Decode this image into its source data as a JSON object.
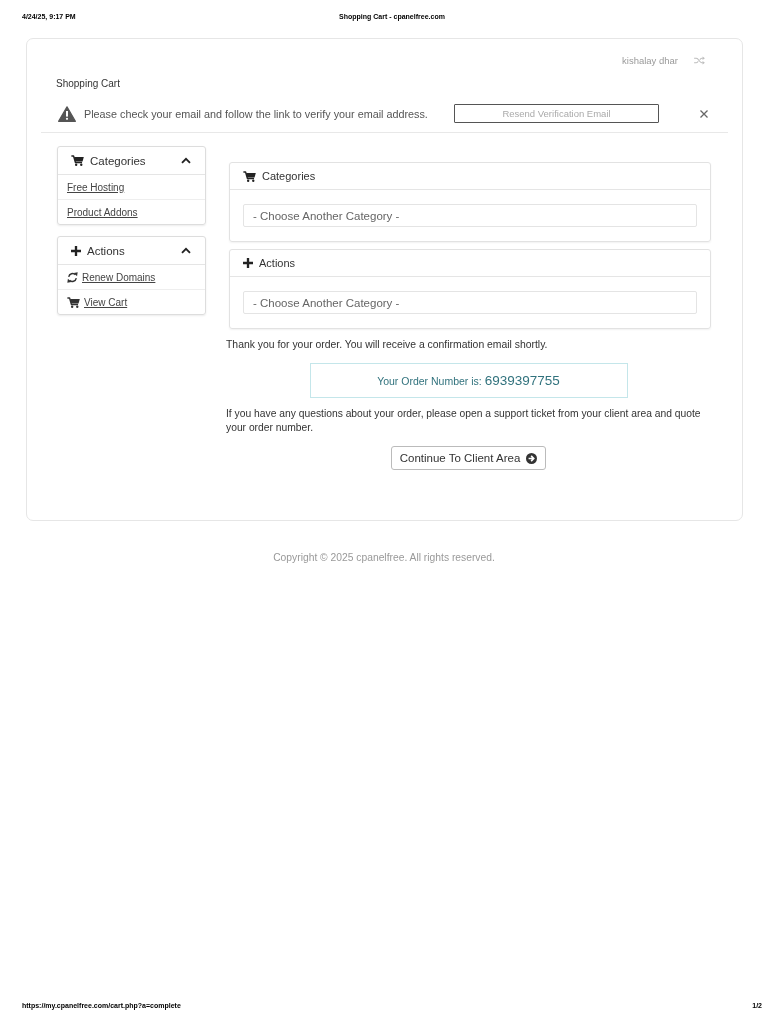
{
  "print_header": {
    "date": "4/24/25, 9:17 PM",
    "title": "Shopping Cart - cpanelfree.com"
  },
  "user": {
    "name": "kishalay dhar"
  },
  "page_title": "Shopping Cart",
  "alert": {
    "message": "Please check your email and follow the link to verify your email address.",
    "button": "Resend Verification Email"
  },
  "sidebar": [
    {
      "title": "Categories",
      "kind": "cart",
      "expanded": true,
      "items": [
        {
          "label": "Free Hosting",
          "kind": "plain"
        },
        {
          "label": "Product Addons",
          "kind": "plain"
        }
      ]
    },
    {
      "title": "Actions",
      "kind": "plus",
      "expanded": true,
      "items": [
        {
          "label": "Renew Domains",
          "kind": "refresh"
        },
        {
          "label": "View Cart",
          "kind": "cart"
        }
      ]
    }
  ],
  "panels": [
    {
      "title": "Categories",
      "kind": "cart",
      "select": {
        "value": "- Choose Another Category -"
      }
    },
    {
      "title": "Actions",
      "kind": "plus",
      "select": {
        "value": "- Choose Another Category -"
      }
    }
  ],
  "confirmation": "Thank you for your order. You will receive a confirmation email shortly.",
  "order": {
    "label": "Your Order Number is:",
    "number": "6939397755"
  },
  "help_text": "If you have any questions about your order, please open a support ticket from your client area and quote your order number.",
  "continue_button": "Continue To Client Area",
  "copyright": "Copyright © 2025 cpanelfree. All rights reserved.",
  "print_footer": {
    "url": "https://my.cpanelfree.com/cart.php?a=complete",
    "page": "1/2"
  }
}
